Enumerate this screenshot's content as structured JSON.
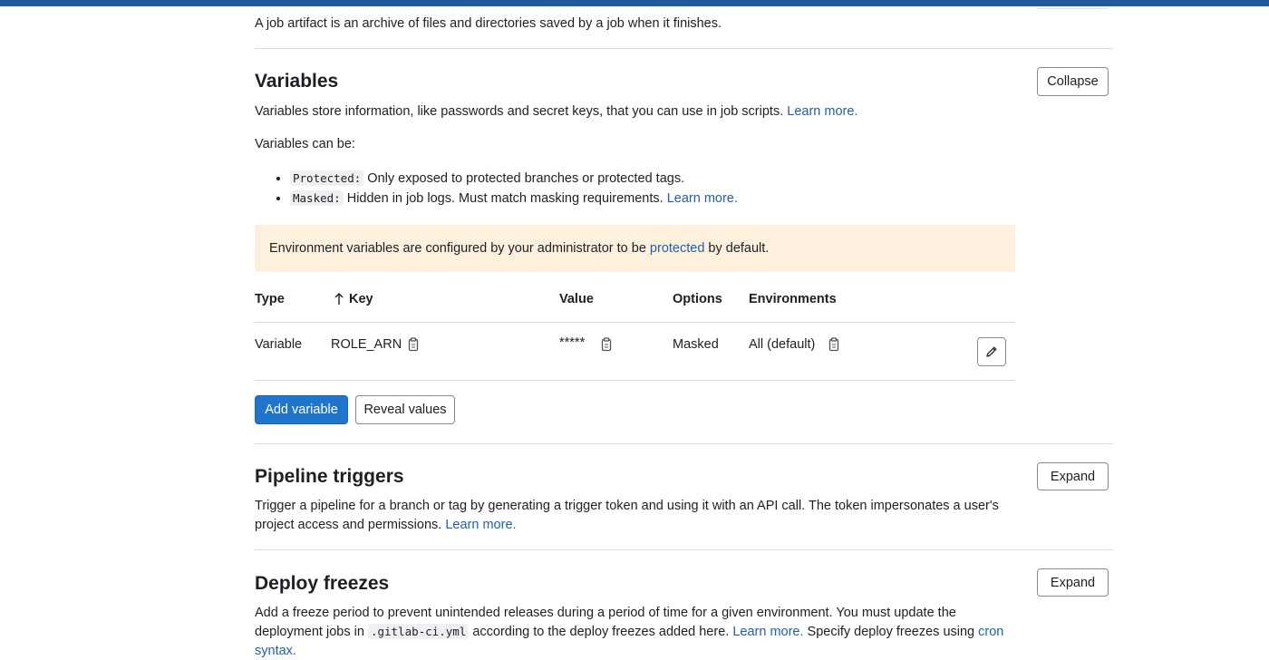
{
  "artifacts": {
    "description": "A job artifact is an archive of files and directories saved by a job when it finishes."
  },
  "variables": {
    "title": "Variables",
    "collapse_label": "Collapse",
    "description": "Variables store information, like passwords and secret keys, that you can use in job scripts.",
    "learn_more": "Learn more.",
    "can_be": "Variables can be:",
    "bullets": [
      {
        "code": "Protected:",
        "text": "Only exposed to protected branches or protected tags.",
        "link": ""
      },
      {
        "code": "Masked:",
        "text": "Hidden in job logs. Must match masking requirements.",
        "link": "Learn more."
      }
    ],
    "alert": {
      "before": "Environment variables are configured by your administrator to be",
      "link": "protected",
      "after": "by default."
    },
    "table": {
      "headers": {
        "type": "Type",
        "key": "Key",
        "value": "Value",
        "options": "Options",
        "environments": "Environments"
      },
      "sort_icon": "arrow-up-icon",
      "rows": [
        {
          "type": "Variable",
          "key": "ROLE_ARN",
          "value": "*****",
          "options": "Masked",
          "environment": "All (default)"
        }
      ]
    },
    "add_label": "Add variable",
    "reveal_label": "Reveal values"
  },
  "pipeline_triggers": {
    "title": "Pipeline triggers",
    "expand_label": "Expand",
    "line1": "Trigger a pipeline for a branch or tag by generating a trigger token and using it with an API call. The token impersonates a user's",
    "line2": "project access and permissions.",
    "learn_more": "Learn more."
  },
  "deploy_freezes": {
    "title": "Deploy freezes",
    "expand_label": "Expand",
    "line1": "Add a freeze period to prevent unintended releases during a period of time for a given environment. You must update the",
    "line2_a": "deployment jobs in",
    "line2_code": ".gitlab-ci.yml",
    "line2_b": "according to the deploy freezes added here.",
    "learn_more": "Learn more.",
    "line2_c": "Specify deploy freezes using",
    "cron_link": "cron",
    "line3": "syntax."
  },
  "colors": {
    "topbar": "#1f5a9e",
    "link": "#1f5fae",
    "primary": "#1f75cb",
    "alert_bg": "#fdf1dd"
  }
}
